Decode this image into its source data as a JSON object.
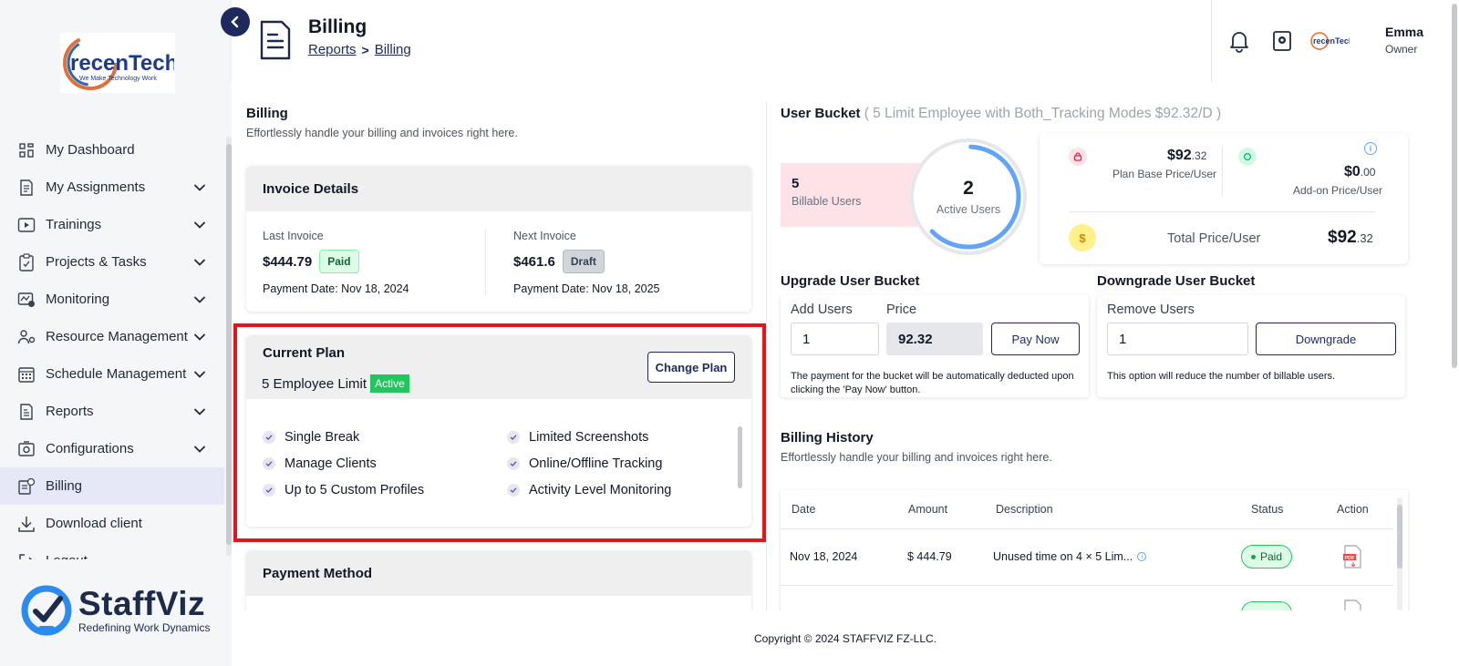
{
  "sidebar": {
    "logo_name": "recenTech",
    "logo_tagline": "We Make Technology Work",
    "items": [
      {
        "label": "My Dashboard",
        "icon": "dashboard-icon",
        "expandable": false
      },
      {
        "label": "My Assignments",
        "icon": "assignments-icon",
        "expandable": true
      },
      {
        "label": "Trainings",
        "icon": "play-icon",
        "expandable": true
      },
      {
        "label": "Projects & Tasks",
        "icon": "clipboard-icon",
        "expandable": true
      },
      {
        "label": "Monitoring",
        "icon": "monitoring-icon",
        "expandable": true
      },
      {
        "label": "Resource Management",
        "icon": "people-gear-icon",
        "expandable": true
      },
      {
        "label": "Schedule Management",
        "icon": "calendar-icon",
        "expandable": true
      },
      {
        "label": "Reports",
        "icon": "report-icon",
        "expandable": true
      },
      {
        "label": "Configurations",
        "icon": "config-icon",
        "expandable": true
      },
      {
        "label": "Billing",
        "icon": "billing-icon",
        "expandable": false,
        "active": true
      },
      {
        "label": "Download client",
        "icon": "download-icon",
        "expandable": false
      },
      {
        "label": "Logout",
        "icon": "logout-icon",
        "expandable": false
      }
    ],
    "brand_name": "StaffViz",
    "brand_tagline": "Redefining Work Dynamics"
  },
  "header": {
    "title": "Billing",
    "breadcrumb": [
      "Reports",
      "Billing"
    ],
    "user_name": "Emma",
    "user_role": "Owner",
    "avatar_text": "recenTech"
  },
  "billing": {
    "title": "Billing",
    "subtitle": "Effortlessly handle your billing and invoices right here."
  },
  "invoice": {
    "title": "Invoice Details",
    "last_label": "Last Invoice",
    "last_amount": "$444.79",
    "last_status": "Paid",
    "last_date": "Payment Date: Nov 18, 2024",
    "next_label": "Next Invoice",
    "next_amount": "$461.6",
    "next_status": "Draft",
    "next_date": "Payment Date: Nov 18, 2025"
  },
  "plan": {
    "title": "Current Plan",
    "name": "5 Employee Limit",
    "status": "Active",
    "change_label": "Change Plan",
    "features_left": [
      "Single Break",
      "Manage Clients",
      "Up to 5 Custom Profiles"
    ],
    "features_right": [
      "Limited Screenshots",
      "Online/Offline Tracking",
      "Activity Level Monitoring"
    ]
  },
  "payment": {
    "title": "Payment Method"
  },
  "bucket": {
    "title": "User Bucket",
    "detail": "( 5 Limit Employee with Both_Tracking Modes $92.32/D )",
    "billable_count": "5",
    "billable_label": "Billable Users",
    "active_count": "2",
    "active_label": "Active Users",
    "active_ratio": 0.4,
    "base_price": "$92",
    "base_cents": ".32",
    "base_label": "Plan Base Price/User",
    "addon_price": "$0",
    "addon_cents": ".00",
    "addon_label": "Add-on Price/User",
    "total_label": "Total Price/User",
    "total_price": "$92",
    "total_cents": ".32"
  },
  "upgrade": {
    "title": "Upgrade User Bucket",
    "add_label": "Add Users",
    "add_value": "1",
    "price_label": "Price",
    "price_value": "92.32",
    "pay_label": "Pay Now",
    "note_line1": "The payment for the bucket will be automatically deducted upon",
    "note_line2": "clicking the 'Pay Now' button."
  },
  "downgrade": {
    "title": "Downgrade User Bucket",
    "remove_label": "Remove Users",
    "remove_value": "1",
    "button_label": "Downgrade",
    "note": "This option will reduce the number of billable users."
  },
  "history": {
    "title": "Billing History",
    "subtitle": "Effortlessly handle your billing and invoices right here.",
    "columns": [
      "Date",
      "Amount",
      "Description",
      "Status",
      "Action"
    ],
    "rows": [
      {
        "date": "Nov 18, 2024",
        "amount": "$ 444.79",
        "description": "Unused time on 4 × 5 Lim...",
        "status": "Paid"
      }
    ]
  },
  "footer": {
    "copyright": "Copyright © 2024 STAFFVIZ FZ-LLC."
  },
  "colors": {
    "primary": "#1e2a5e",
    "accent": "#e5131a",
    "success": "#22c55e",
    "ring": "#60a5fa"
  }
}
